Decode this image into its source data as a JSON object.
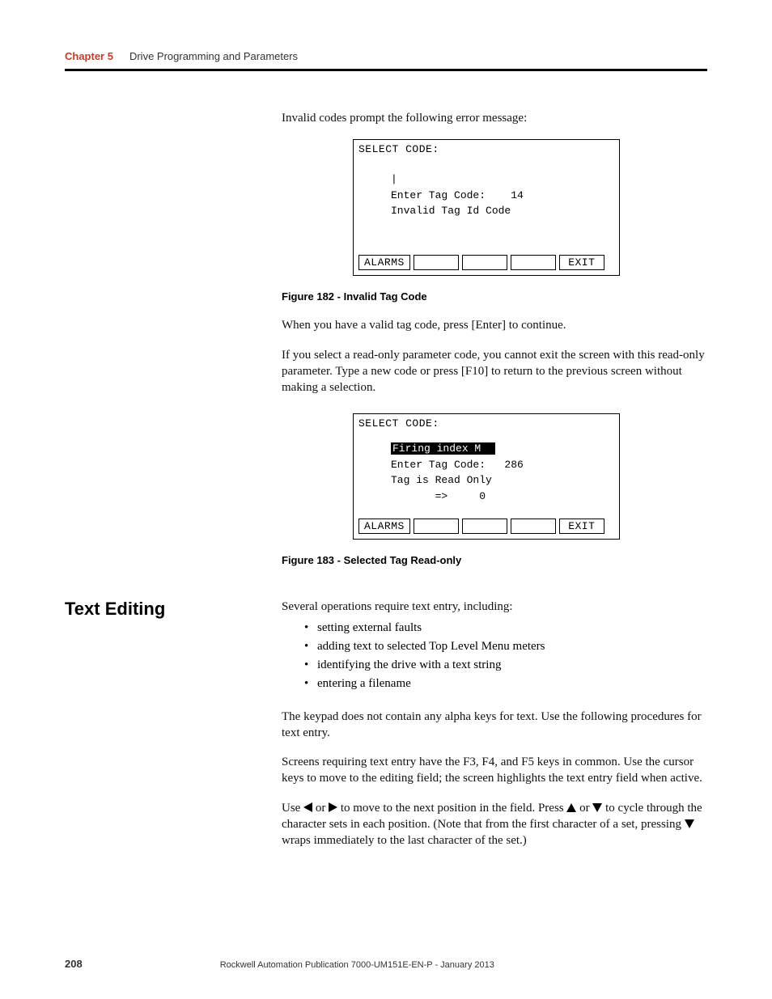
{
  "header": {
    "chapter_label": "Chapter 5",
    "chapter_title": "Drive Programming and Parameters"
  },
  "intro_para": "Invalid codes prompt the following error message:",
  "screen1": {
    "title": "SELECT CODE:",
    "cursor": "|",
    "line_enter": "Enter Tag Code:    14",
    "line_error": "Invalid Tag Id Code",
    "btn_alarms": "ALARMS",
    "btn_exit": "EXIT"
  },
  "fig182_caption": "Figure 182 - Invalid Tag Code",
  "para_after_fig182_1": "When you have a valid tag code, press [Enter] to continue.",
  "para_after_fig182_2": "If you select a read-only parameter code, you cannot exit the screen with this read-only parameter. Type a new code or press [F10] to return to the previous screen without making a selection.",
  "screen2": {
    "title": "SELECT CODE:",
    "hl_text": "Firing index M  ",
    "line_enter": "Enter Tag Code:   286",
    "line_readonly": "Tag is Read Only",
    "line_arrow": "       =>     0",
    "btn_alarms": "ALARMS",
    "btn_exit": "EXIT"
  },
  "fig183_caption": "Figure 183 - Selected Tag Read-only",
  "text_editing": {
    "heading": "Text Editing",
    "intro": "Several operations require text entry, including:",
    "bullets": [
      "setting external faults",
      "adding text to selected Top Level Menu meters",
      "identifying the drive with a text string",
      "entering a filename"
    ],
    "p2": "The keypad does not contain any alpha keys for text. Use the following procedures for text entry.",
    "p3": "Screens requiring text entry have the F3, F4, and F5 keys in common. Use the cursor keys to move to the editing field; the screen highlights the text entry field when active.",
    "p4_a": "Use ",
    "p4_b": " or ",
    "p4_c": " to move to the next position in the field. Press ",
    "p4_d": " or ",
    "p4_e": " to cycle through the character sets in each position. (Note that from the first character of a set, pressing ",
    "p4_f": " wraps immediately to the last character of the set.)"
  },
  "footer": {
    "page_num": "208",
    "pub": "Rockwell Automation Publication 7000-UM151E-EN-P - January 2013"
  }
}
